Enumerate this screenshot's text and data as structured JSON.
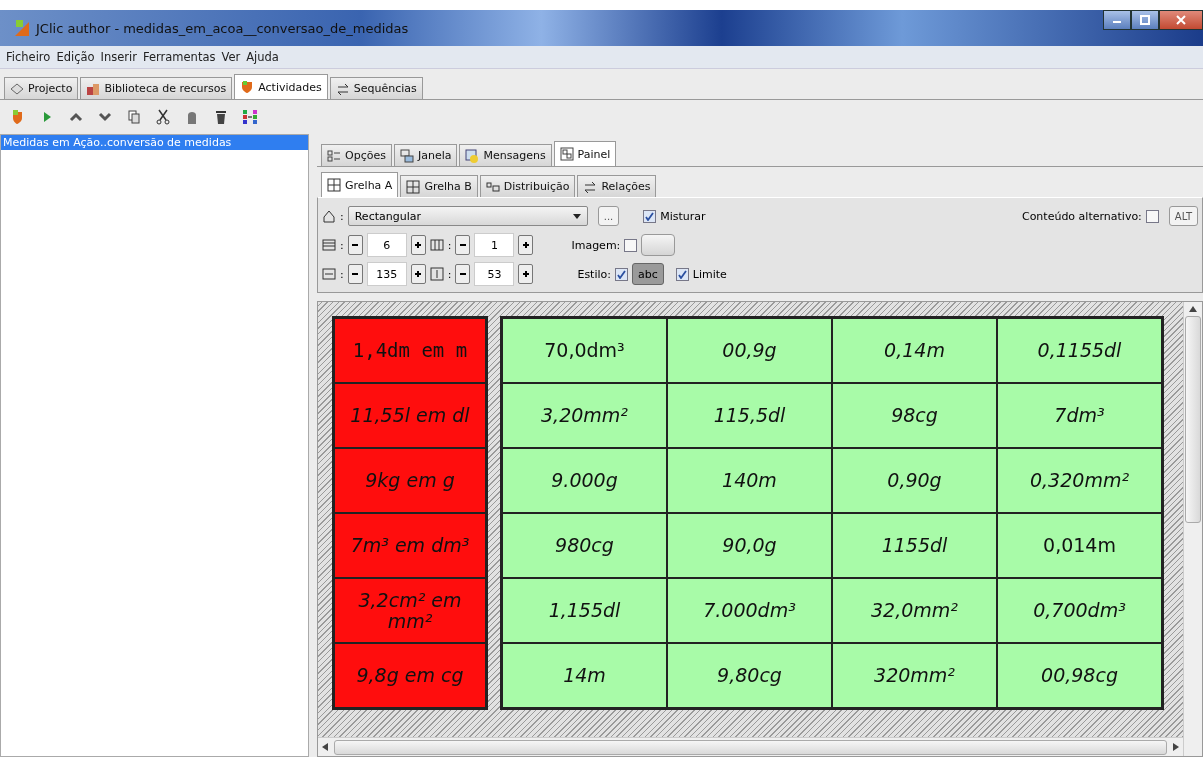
{
  "window": {
    "title": "JClic author - medidas_em_acoa__conversao_de_medidas"
  },
  "menu": [
    "Ficheiro",
    "Edição",
    "Inserir",
    "Ferramentas",
    "Ver",
    "Ajuda"
  ],
  "tabs": [
    {
      "label": "Projecto",
      "selected": false
    },
    {
      "label": "Biblioteca de recursos",
      "selected": false
    },
    {
      "label": "Actividades",
      "selected": true
    },
    {
      "label": "Sequências",
      "selected": false
    }
  ],
  "activities": [
    {
      "label": "Medidas em Ação..conversão de medidas",
      "selected": true
    }
  ],
  "panel_tabs": [
    {
      "label": "Opções",
      "selected": false
    },
    {
      "label": "Janela",
      "selected": false
    },
    {
      "label": "Mensagens",
      "selected": false
    },
    {
      "label": "Painel",
      "selected": true
    }
  ],
  "sub_tabs": [
    {
      "label": "Grelha A",
      "selected": true
    },
    {
      "label": "Grelha B",
      "selected": false
    },
    {
      "label": "Distribuição",
      "selected": false
    },
    {
      "label": "Relações",
      "selected": false
    }
  ],
  "shape": {
    "label": ":",
    "value": "Rectangular",
    "more": "..."
  },
  "shuffle": {
    "label": "Misturar",
    "checked": true
  },
  "alternative": {
    "label": "Conteúdo alternativo:",
    "checked": false,
    "button": "ALT"
  },
  "rows_spin": {
    "label": ":",
    "value": "6"
  },
  "cols_spin": {
    "label": ":",
    "value": "1"
  },
  "width_spin": {
    "label": ":",
    "value": "135"
  },
  "height_spin": {
    "label": ":",
    "value": "53"
  },
  "image": {
    "label": "Imagem:",
    "checked": false
  },
  "style": {
    "label": "Estilo:",
    "checked": true,
    "button": "abc"
  },
  "border": {
    "label": "Limite",
    "checked": true
  },
  "grid_a": {
    "color": "#ff0d0d",
    "cells": [
      {
        "text": "1,4dm em m",
        "kind": "mono"
      },
      {
        "text": "11,55l em dl",
        "kind": "italic"
      },
      {
        "text": "9kg em g",
        "kind": "italic"
      },
      {
        "text": "7m³ em dm³",
        "kind": "italic"
      },
      {
        "text": "3,2cm² em mm²",
        "kind": "italic"
      },
      {
        "text": "9,8g em cg",
        "kind": "italic"
      }
    ]
  },
  "grid_b": {
    "color": "#a8fba8",
    "cells": [
      {
        "text": "70,0dm³",
        "kind": "plain"
      },
      {
        "text": "00,9g",
        "kind": "italic"
      },
      {
        "text": "0,14m",
        "kind": "italic"
      },
      {
        "text": "0,1155dl",
        "kind": "italic"
      },
      {
        "text": "3,20mm²",
        "kind": "italic"
      },
      {
        "text": "115,5dl",
        "kind": "italic"
      },
      {
        "text": "98cg",
        "kind": "italic"
      },
      {
        "text": "7dm³",
        "kind": "italic"
      },
      {
        "text": "9.000g",
        "kind": "italic"
      },
      {
        "text": "140m",
        "kind": "italic"
      },
      {
        "text": "0,90g",
        "kind": "italic"
      },
      {
        "text": "0,320mm²",
        "kind": "italic"
      },
      {
        "text": "980cg",
        "kind": "italic"
      },
      {
        "text": "90,0g",
        "kind": "italic"
      },
      {
        "text": "1155dl",
        "kind": "italic"
      },
      {
        "text": "0,014m",
        "kind": "plain"
      },
      {
        "text": "1,155dl",
        "kind": "italic"
      },
      {
        "text": "7.000dm³",
        "kind": "italic"
      },
      {
        "text": "32,0mm²",
        "kind": "italic"
      },
      {
        "text": "0,700dm³",
        "kind": "italic"
      },
      {
        "text": "14m",
        "kind": "italic"
      },
      {
        "text": "9,80cg",
        "kind": "italic"
      },
      {
        "text": "320mm²",
        "kind": "italic"
      },
      {
        "text": "00,98cg",
        "kind": "italic"
      }
    ]
  }
}
